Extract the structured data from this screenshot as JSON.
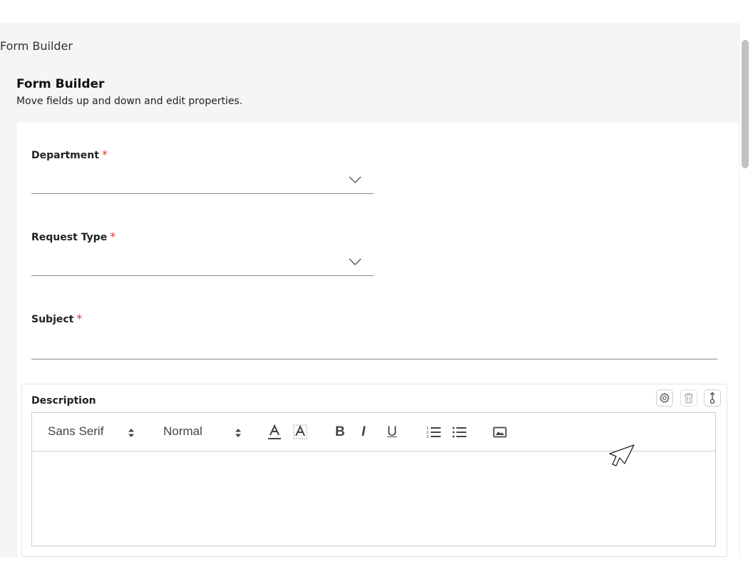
{
  "window": {
    "title": "Form Builder"
  },
  "header": {
    "title": "Form Builder",
    "subtitle": "Move fields up and down and edit properties."
  },
  "fields": [
    {
      "label": "Department",
      "required_mark": "*",
      "type": "select",
      "value": ""
    },
    {
      "label": "Request Type",
      "required_mark": "*",
      "type": "select",
      "value": ""
    },
    {
      "label": "Subject",
      "required_mark": "*",
      "type": "text",
      "value": ""
    }
  ],
  "description_field": {
    "label": "Description",
    "controls": [
      "settings-icon",
      "trash-icon",
      "move-icon"
    ],
    "toolbar": {
      "font_family": "Sans Serif",
      "font_size": "Normal",
      "bold": "B",
      "italic": "I",
      "underline": "U",
      "icons": [
        "text-color-icon",
        "highlight-color-icon",
        "ordered-list-icon",
        "bullet-list-icon",
        "image-icon"
      ]
    },
    "content": ""
  },
  "colors": {
    "required": "#e53935",
    "panel_bg": "#f5f5f5",
    "line": "#8a8a8a"
  }
}
